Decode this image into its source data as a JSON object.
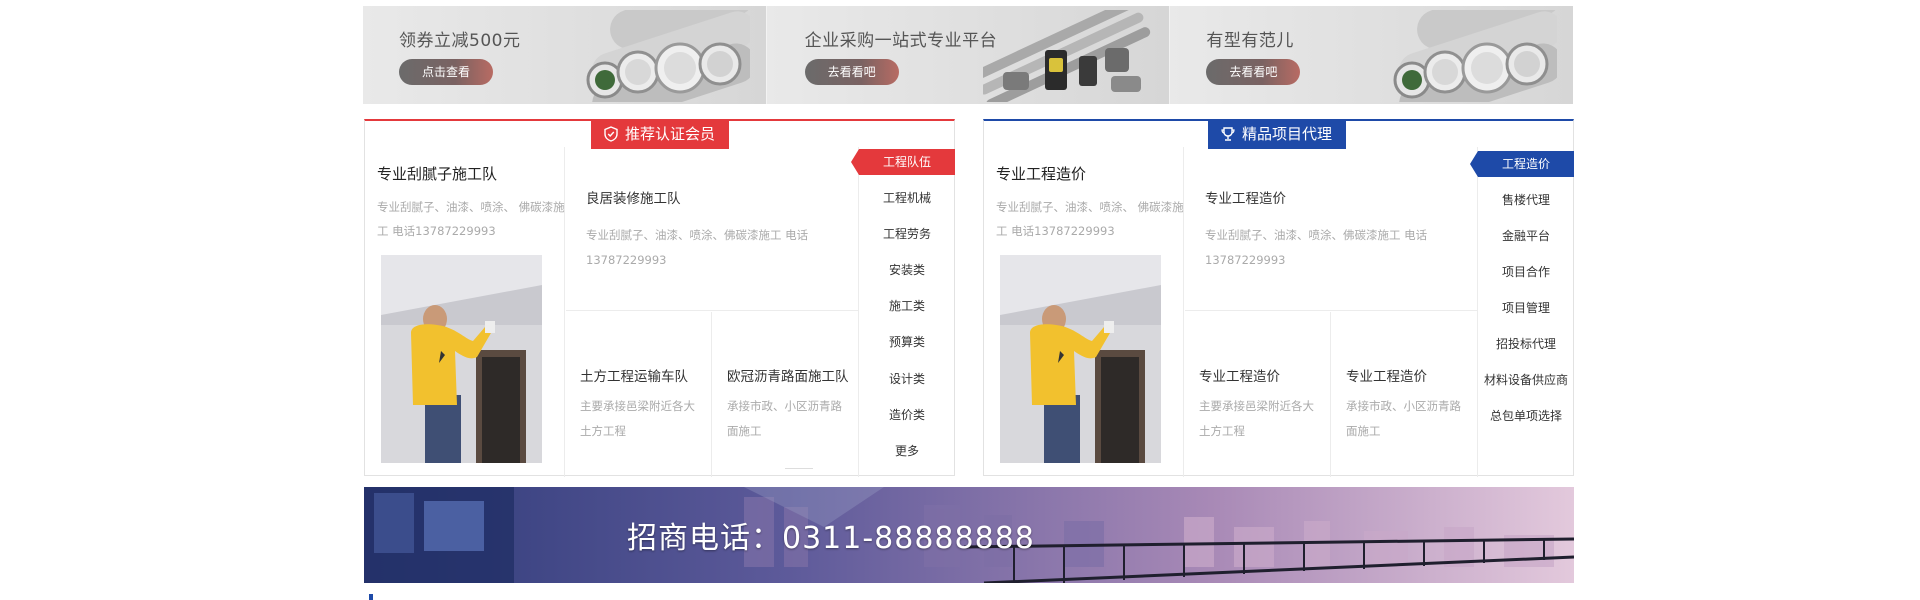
{
  "promos": [
    {
      "title": "领券立减500元",
      "button": "点击查看"
    },
    {
      "title": "企业采购一站式专业平台",
      "button": "去看看吧"
    },
    {
      "title": "有型有范儿",
      "button": "去看看吧"
    }
  ],
  "panels": [
    {
      "tag": "推荐认证会员",
      "accent": "#e4393c",
      "feature": {
        "title": "专业刮腻子施工队",
        "desc": "专业刮腻子、油漆、喷涂、 佛碳漆施工 电话13787229993"
      },
      "top": {
        "title": "良居装修施工队",
        "desc": "专业刮腻子、油漆、喷涂、佛碳漆施工 电话13787229993"
      },
      "bottom_left": {
        "title": "土方工程运输车队",
        "desc": "主要承接邑梁附近各大土方工程"
      },
      "bottom_right": {
        "title": "欧冠沥青路面施工队",
        "desc": "承接市政、小区沥青路面施工"
      },
      "nav": [
        "工程队伍",
        "工程机械",
        "工程劳务",
        "安装类",
        "施工类",
        "预算类",
        "设计类",
        "造价类",
        "更多"
      ]
    },
    {
      "tag": "精品项目代理",
      "accent": "#1e4aa8",
      "feature": {
        "title": "专业工程造价",
        "desc": "专业刮腻子、油漆、喷涂、 佛碳漆施工 电话13787229993"
      },
      "top": {
        "title": "专业工程造价",
        "desc": "专业刮腻子、油漆、喷涂、佛碳漆施工 电话13787229993"
      },
      "bottom_left": {
        "title": "专业工程造价",
        "desc": "主要承接邑梁附近各大土方工程"
      },
      "bottom_right": {
        "title": "专业工程造价",
        "desc": "承接市政、小区沥青路面施工"
      },
      "nav": [
        "工程造价",
        "售楼代理",
        "金融平台",
        "项目合作",
        "项目管理",
        "招投标代理",
        "材料设备供应商",
        "总包单项选择"
      ]
    }
  ],
  "banner": {
    "text": "招商电话：0311-88888888"
  },
  "icons": {
    "panel_left_tag": "shield-check-icon",
    "panel_right_tag": "trophy-icon"
  },
  "colors": {
    "red_accent": "#e4393c",
    "blue_accent": "#1e4aa8"
  }
}
